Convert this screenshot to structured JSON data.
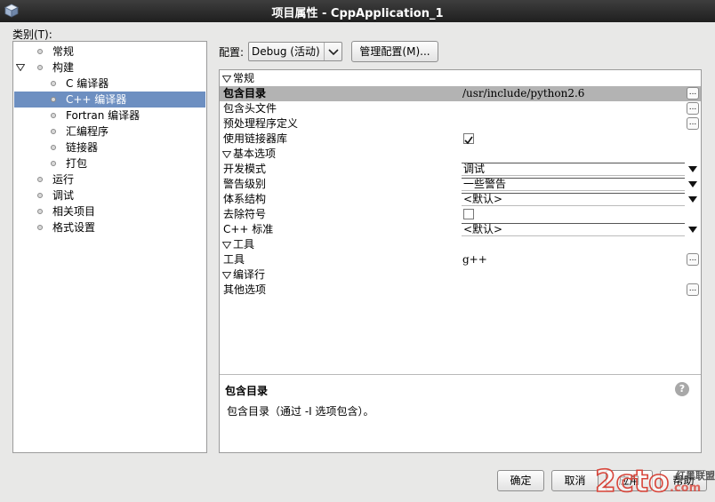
{
  "window": {
    "title": "项目属性 - CppApplication_1"
  },
  "categories": {
    "label": "类别(T):",
    "items": [
      {
        "label": "常规",
        "level": 0,
        "expanded": null,
        "selected": false
      },
      {
        "label": "构建",
        "level": 0,
        "expanded": true,
        "selected": false
      },
      {
        "label": "C 编译器",
        "level": 1,
        "expanded": null,
        "selected": false
      },
      {
        "label": "C++ 编译器",
        "level": 1,
        "expanded": null,
        "selected": true
      },
      {
        "label": "Fortran 编译器",
        "level": 1,
        "expanded": null,
        "selected": false
      },
      {
        "label": "汇编程序",
        "level": 1,
        "expanded": null,
        "selected": false
      },
      {
        "label": "链接器",
        "level": 1,
        "expanded": null,
        "selected": false
      },
      {
        "label": "打包",
        "level": 1,
        "expanded": null,
        "selected": false
      },
      {
        "label": "运行",
        "level": 0,
        "expanded": null,
        "selected": false
      },
      {
        "label": "调试",
        "level": 0,
        "expanded": null,
        "selected": false
      },
      {
        "label": "相关项目",
        "level": 0,
        "expanded": null,
        "selected": false
      },
      {
        "label": "格式设置",
        "level": 0,
        "expanded": null,
        "selected": false
      }
    ]
  },
  "config": {
    "label": "配置:",
    "selected": "Debug (活动)",
    "manage_button": "管理配置(M)..."
  },
  "properties": {
    "rows": [
      {
        "type": "section",
        "name": "常规"
      },
      {
        "type": "text",
        "name": "包含目录",
        "value": "/usr/include/python2.6",
        "ellipsis": true,
        "selected": true
      },
      {
        "type": "text",
        "name": "包含头文件",
        "value": "",
        "ellipsis": true
      },
      {
        "type": "text",
        "name": "预处理程序定义",
        "value": "",
        "ellipsis": true
      },
      {
        "type": "checkbox",
        "name": "使用链接器库",
        "checked": true
      },
      {
        "type": "section",
        "name": "基本选项"
      },
      {
        "type": "combo",
        "name": "开发模式",
        "value": "调试"
      },
      {
        "type": "combo",
        "name": "警告级别",
        "value": "一些警告"
      },
      {
        "type": "combo",
        "name": "体系结构",
        "value": "<默认>"
      },
      {
        "type": "checkbox",
        "name": "去除符号",
        "checked": false
      },
      {
        "type": "combo",
        "name": "C++ 标准",
        "value": "<默认>"
      },
      {
        "type": "section",
        "name": "工具"
      },
      {
        "type": "text",
        "name": "工具",
        "value": "g++",
        "ellipsis": true
      },
      {
        "type": "section",
        "name": "编译行"
      },
      {
        "type": "text",
        "name": "其他选项",
        "value": "",
        "ellipsis": true
      }
    ]
  },
  "description": {
    "title": "包含目录",
    "text": "包含目录（通过 -I 选项包含）。"
  },
  "buttons": {
    "ok": "确定",
    "cancel": "取消",
    "apply": "应用",
    "help": "帮助"
  },
  "watermark": {
    "logo": "2cto.com",
    "text": "红黑联盟"
  }
}
